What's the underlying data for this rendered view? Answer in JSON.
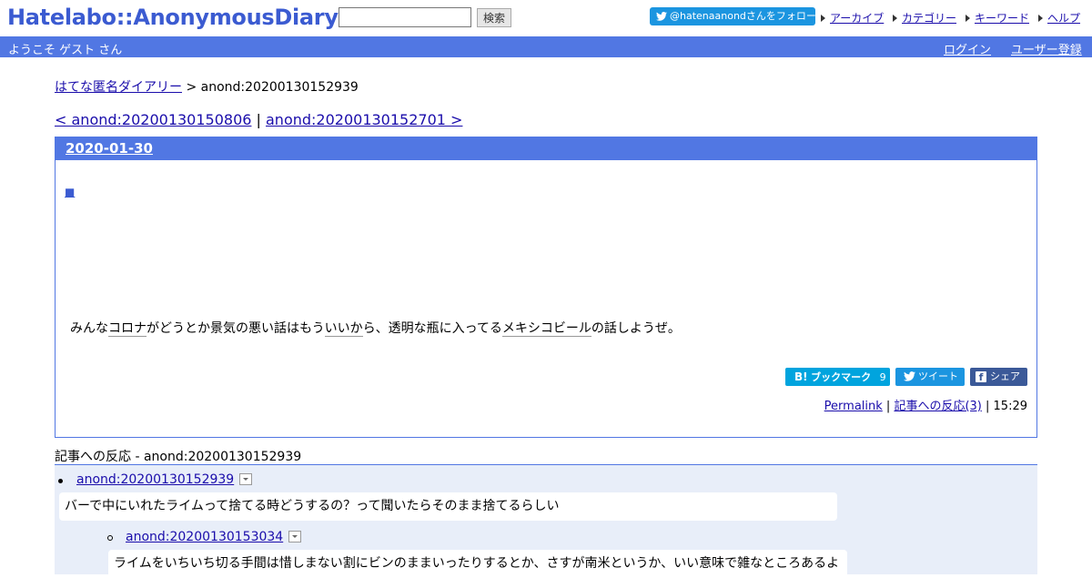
{
  "header": {
    "logo": "Hatelabo::AnonymousDiary",
    "search_value": "",
    "search_button": "検索",
    "follow_button": "@hatenaanondさんをフォロー",
    "links": [
      "アーカイブ",
      "カテゴリー",
      "キーワード",
      "ヘルプ"
    ]
  },
  "bar": {
    "welcome": "ようこそ ゲスト さん",
    "login": "ログイン",
    "register": "ユーザー登録"
  },
  "breadcrumb": {
    "home": "はてな匿名ダイアリー",
    "separator": " > ",
    "current": "anond:20200130152939"
  },
  "pager": {
    "prev": "< anond:20200130150806",
    "sep": " | ",
    "next": "anond:20200130152701 >"
  },
  "entry": {
    "date": "2020-01-30",
    "square": "■",
    "body_parts": [
      "みんな",
      "コロナ",
      "がどうとか景気の悪い話はもう",
      "いいか",
      "ら、透明な瓶に入ってる",
      "メキシコビール",
      "の話しようぜ。"
    ],
    "share": {
      "bookmark": "ブックマーク",
      "bookmark_count": "9",
      "tweet": "ツイート",
      "facebook": "シェア"
    },
    "meta": {
      "permalink": "Permalink",
      "sep": " | ",
      "reactions": "記事への反応(3)",
      "time": "15:29"
    }
  },
  "reactions": {
    "title": "記事への反応 - anond:20200130152939",
    "items": [
      {
        "id": "anond:20200130152939",
        "text": "バーで中にいれたライムって捨てる時どうするの？って聞いたらそのまま捨てるらしい"
      },
      {
        "id": "anond:20200130153034",
        "text": "ライムをいちいち切る手間は惜しまない割にビンのままいったりするとか、さすが南米というか、いい意味で雑なところあるよ"
      }
    ]
  },
  "colors": {
    "brand": "#5177e3",
    "logo": "#3b5bd1",
    "twitter": "#1b95e0",
    "hatena_bookmark": "#00a4de",
    "facebook": "#3b5998",
    "reactions_bg": "#e8eef9"
  }
}
